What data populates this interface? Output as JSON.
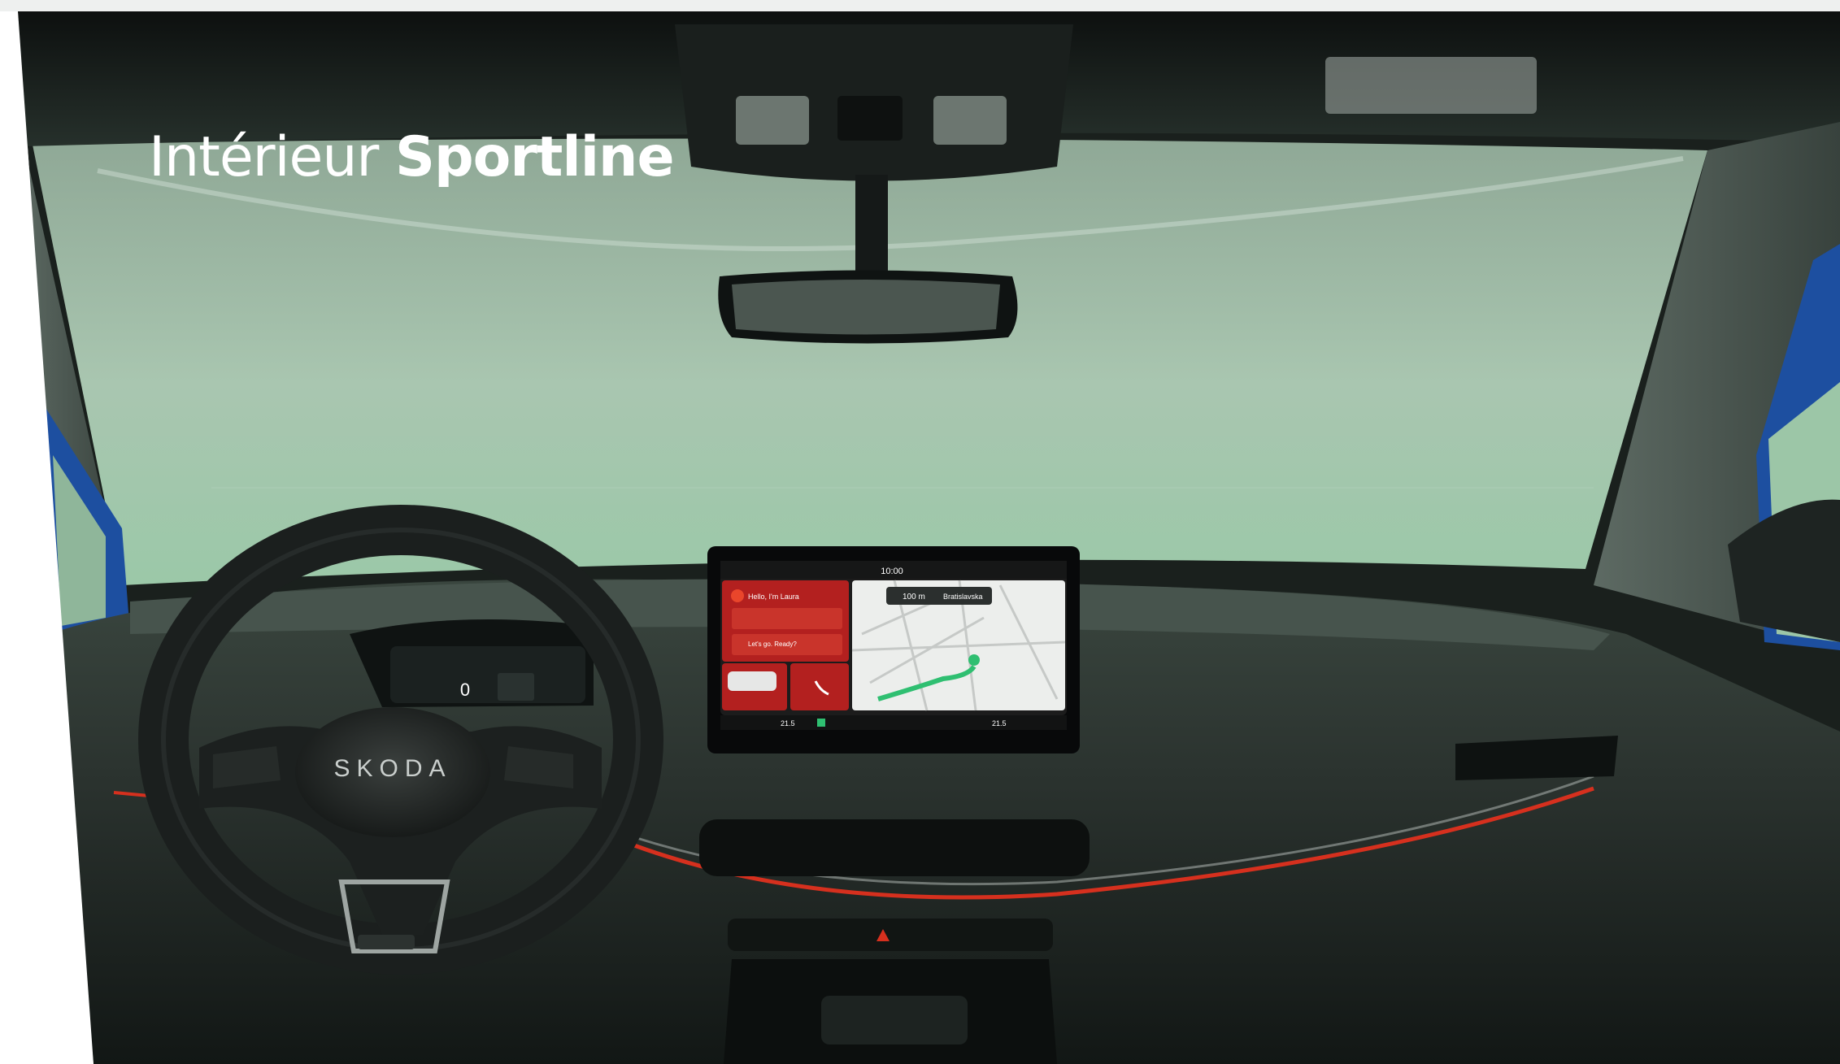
{
  "heading": {
    "light": "Intérieur",
    "bold": "Sportline"
  },
  "steering_wheel": {
    "logo": "SKODA"
  },
  "instrument_cluster": {
    "speed": "0"
  },
  "infotainment": {
    "clock": "10:00",
    "assistant_greeting": "Hello, I'm Laura",
    "assistant_prompt": "Let's go. Ready?",
    "nav_distance": "100 m",
    "nav_street": "Bratislavska",
    "temp_left": "21.5",
    "temp_right": "21.5"
  },
  "colors": {
    "ambient_red": "#d6301e",
    "screen_red": "#b3201f",
    "route_green": "#2fbf71",
    "body_blue": "#1d4fa0"
  }
}
